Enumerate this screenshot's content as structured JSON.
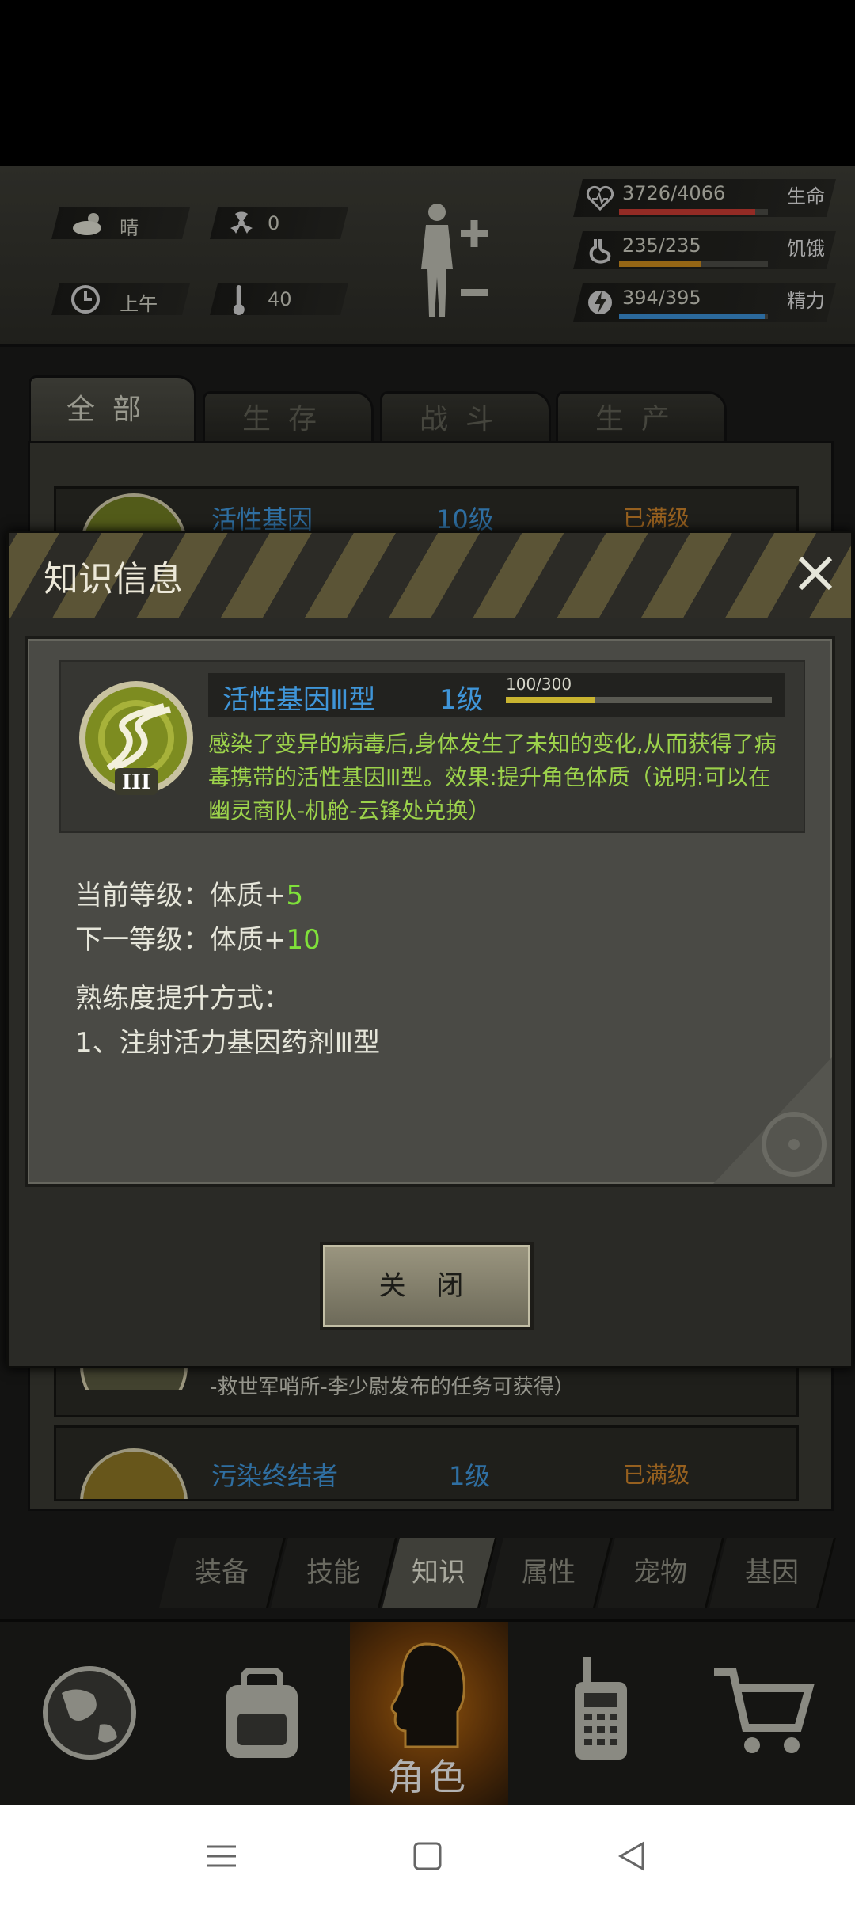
{
  "weather": {
    "icon": "cloud-sun-icon",
    "label": "晴",
    "radiation": "0",
    "time": "上午",
    "temperature": "40"
  },
  "vitals": [
    {
      "icon": "heart-icon",
      "value": "3726/4066",
      "label": "生命",
      "fill": 0.9165,
      "color": "#c43a32"
    },
    {
      "icon": "stomach-icon",
      "value": "235/235",
      "label": "饥饿",
      "fill": 0.55,
      "color": "#c7891c"
    },
    {
      "icon": "energy-icon",
      "value": "394/395",
      "label": "精力",
      "fill": 0.98,
      "color": "#3a8dd1"
    }
  ],
  "category_tabs": [
    "全部",
    "生存",
    "战斗",
    "生产"
  ],
  "list_rows": [
    {
      "name": "活性基因",
      "level": "10级",
      "status": "已满级"
    },
    {
      "desc_tail": "-救世军哨所-李少尉发布的任务可获得）"
    },
    {
      "name": "污染终结者",
      "level": "1级",
      "status": "已满级"
    }
  ],
  "dialog": {
    "title": "知识信息",
    "skill_name": "活性基因Ⅲ型",
    "skill_level": "1级",
    "progress_text": "100/300",
    "progress": 0.333,
    "description": "感染了变异的病毒后,身体发生了未知的变化,从而获得了病毒携带的活性基因Ⅲ型。效果:提升角色体质（说明:可以在幽灵商队-机舱-云锋处兑换）",
    "current_label": "当前等级：体质+",
    "current_value": "5",
    "next_label": "下一等级：体质+",
    "next_value": "10",
    "method_title": "熟练度提升方式：",
    "method_1": "1、注射活力基因药剂Ⅲ型",
    "close_button": "关 闭"
  },
  "sub_tabs": [
    "装备",
    "技能",
    "知识",
    "属性",
    "宠物",
    "基因"
  ],
  "active_sub_tab": "知识",
  "bottom_nav": {
    "active_label": "角色",
    "items": [
      "globe-icon",
      "backpack-icon",
      "character-icon",
      "radio-icon",
      "cart-icon"
    ]
  }
}
